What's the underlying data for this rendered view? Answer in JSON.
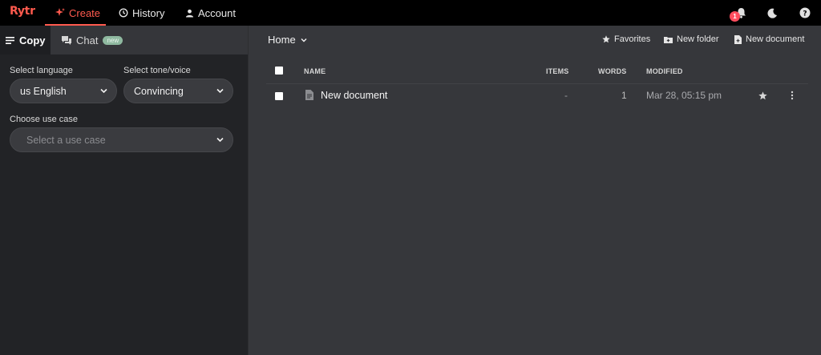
{
  "app": {
    "logo": "Rytr"
  },
  "nav": {
    "create": "Create",
    "history": "History",
    "account": "Account"
  },
  "topbar": {
    "notifications_count": "1"
  },
  "left": {
    "tabs": {
      "copy": "Copy",
      "chat": "Chat",
      "chat_badge": "new"
    },
    "language_label": "Select language",
    "language_value": "us English",
    "tone_label": "Select tone/voice",
    "tone_value": "Convincing",
    "usecase_label": "Choose use case",
    "usecase_placeholder": "Select a use case"
  },
  "main": {
    "breadcrumb": "Home",
    "actions": {
      "favorites": "Favorites",
      "new_folder": "New folder",
      "new_document": "New document"
    },
    "columns": {
      "name": "NAME",
      "items": "ITEMS",
      "words": "WORDS",
      "modified": "MODIFIED"
    },
    "rows": [
      {
        "name": "New document",
        "items": "-",
        "words": "1",
        "modified": "Mar 28, 05:15 pm"
      }
    ]
  },
  "colors": {
    "accent": "#ff5a4e",
    "badge": "#ff4d5e",
    "new_pill": "#8fb9a0"
  }
}
